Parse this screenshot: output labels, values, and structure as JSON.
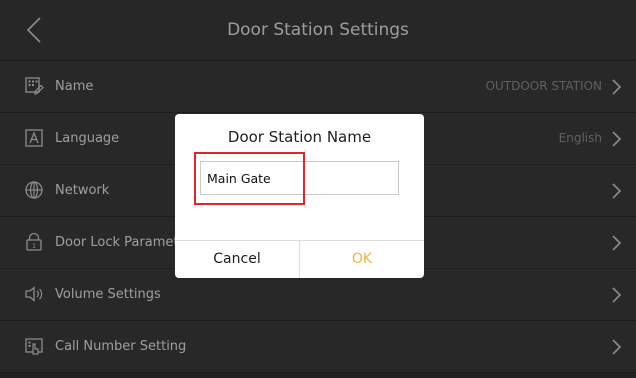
{
  "header": {
    "title": "Door Station Settings",
    "back_icon": "chevron-left-icon"
  },
  "settings": {
    "items": [
      {
        "label": "Name",
        "value": "OUTDOOR STATION",
        "icon": "name-edit-icon"
      },
      {
        "label": "Language",
        "value": "English",
        "icon": "language-icon"
      },
      {
        "label": "Network",
        "value": "",
        "icon": "globe-icon"
      },
      {
        "label": "Door Lock Parameters",
        "value": "",
        "icon": "lock-icon"
      },
      {
        "label": "Volume Settings",
        "value": "",
        "icon": "speaker-icon"
      },
      {
        "label": "Call Number Setting",
        "value": "",
        "icon": "call-number-icon"
      }
    ]
  },
  "dialog": {
    "title": "Door Station Name",
    "input_value": "Main Gate",
    "cancel_label": "Cancel",
    "ok_label": "OK"
  },
  "colors": {
    "accent_ok": "#f0b24a",
    "highlight": "#e0252b",
    "background": "#333333"
  }
}
